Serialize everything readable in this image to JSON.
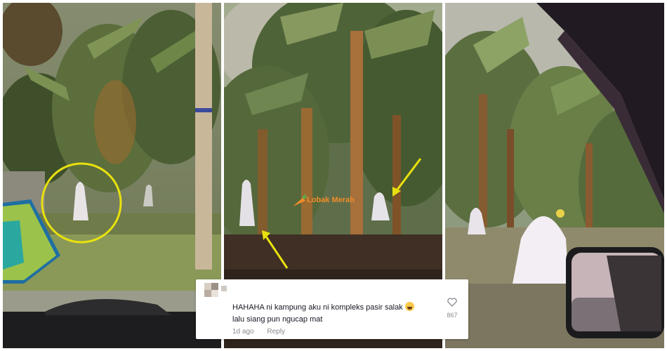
{
  "watermark": {
    "text": "Lobak Merah",
    "icon": "carrot-icon"
  },
  "comment": {
    "text_line1": "HAHAHA ni kampung aku ni kompleks pasir salak",
    "text_line2": "lalu siang pun ngucap mat",
    "emoji": "crying-laughing-emoji",
    "time": "1d ago",
    "reply_label": "Reply",
    "like_count": "867",
    "like_icon": "heart-outline-icon"
  },
  "colors": {
    "highlight_circle": "#e9e10f",
    "arrow": "#e9e10f",
    "watermark": "#f28c28"
  }
}
